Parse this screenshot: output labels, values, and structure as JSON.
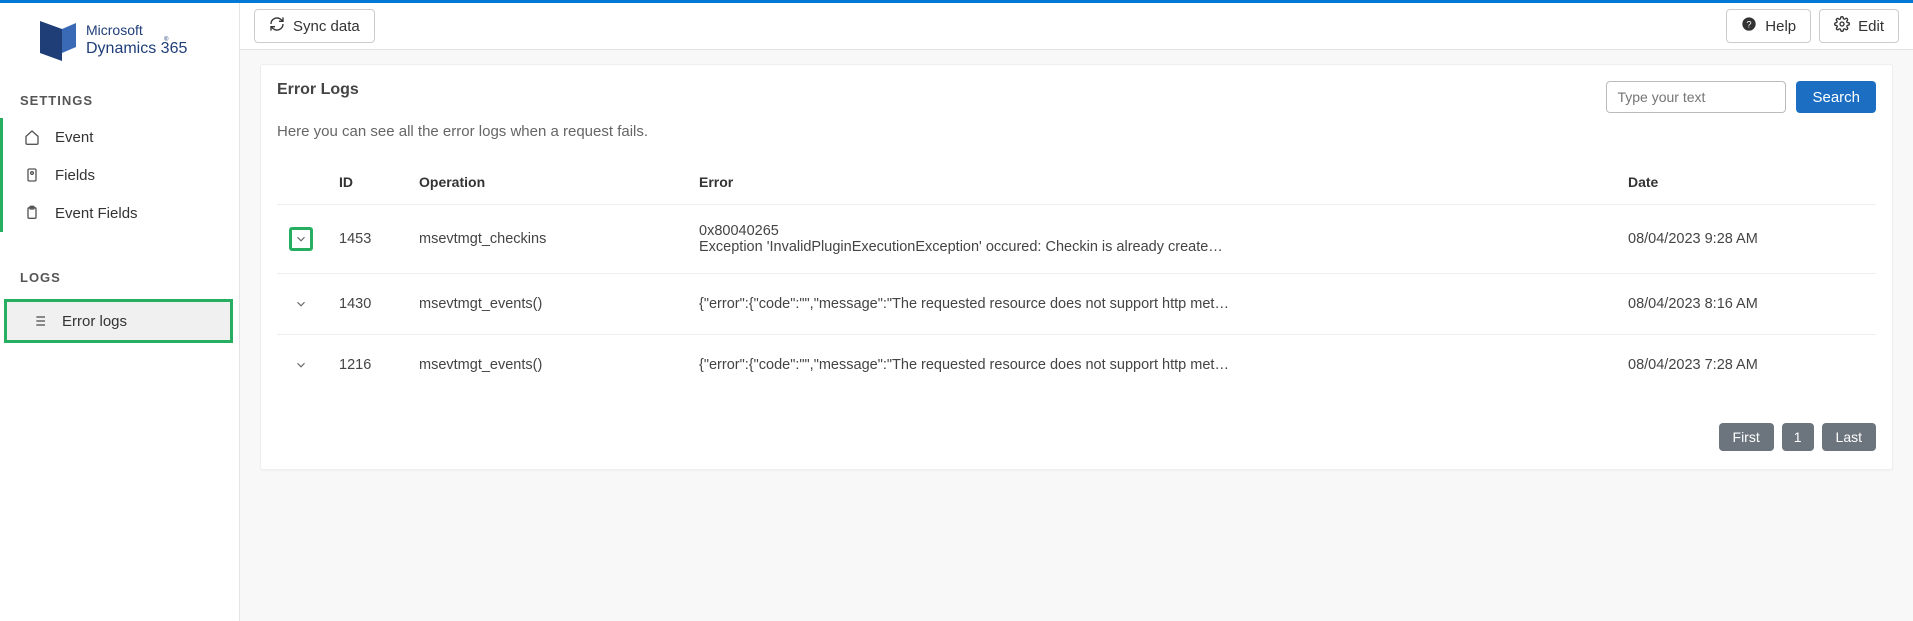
{
  "brand": {
    "line1": "Microsoft",
    "line2": "Dynamics 365"
  },
  "topbar": {
    "sync_label": "Sync data",
    "help_label": "Help",
    "edit_label": "Edit"
  },
  "sidebar": {
    "settings_label": "SETTINGS",
    "logs_label": "LOGS",
    "items": {
      "event": "Event",
      "fields": "Fields",
      "event_fields": "Event Fields",
      "error_logs": "Error logs"
    }
  },
  "page": {
    "title": "Error Logs",
    "subtitle": "Here you can see all the error logs when a request fails.",
    "search_placeholder": "Type your text",
    "search_button": "Search"
  },
  "columns": {
    "id": "ID",
    "operation": "Operation",
    "error": "Error",
    "date": "Date"
  },
  "rows": [
    {
      "id": "1453",
      "operation": "msevtmgt_checkins",
      "error_code": "0x80040265",
      "error_body": "Exception 'InvalidPluginExecutionException' occured: Checkin is already created for this registrati…",
      "date": "08/04/2023 9:28 AM"
    },
    {
      "id": "1430",
      "operation": "msevtmgt_events()",
      "error_code": "",
      "error_body": "{\"error\":{\"code\":\"\",\"message\":\"The requested resource does not support http method 'PATCH'.\"}}",
      "date": "08/04/2023 8:16 AM"
    },
    {
      "id": "1216",
      "operation": "msevtmgt_events()",
      "error_code": "",
      "error_body": "{\"error\":{\"code\":\"\",\"message\":\"The requested resource does not support http method 'PATCH'.\"}}",
      "date": "08/04/2023 7:28 AM"
    }
  ],
  "pager": {
    "first": "First",
    "page": "1",
    "last": "Last"
  }
}
